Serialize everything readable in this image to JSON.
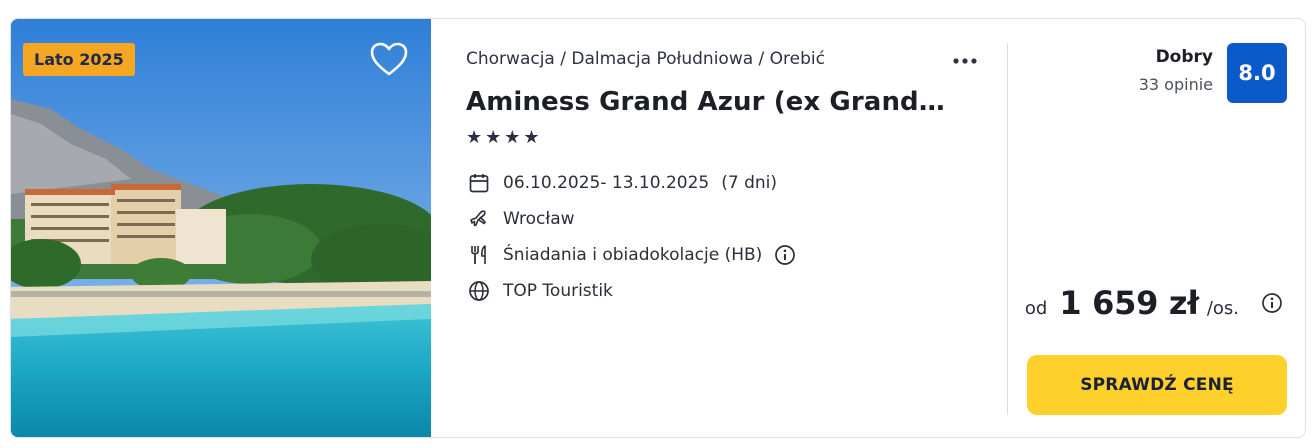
{
  "image": {
    "badge": "Lato 2025",
    "favorite_icon": "heart-outline-icon"
  },
  "info": {
    "breadcrumb": "Chorwacja / Dalmacja Południowa / Orebić",
    "more_icon": "ellipsis-icon",
    "hotel_name": "Aminess Grand Azur (ex Grand…",
    "stars": "★★★★",
    "star_count": 4,
    "dates": "06.10.2025- 13.10.2025",
    "duration": "(7 dni)",
    "departure": "Wrocław",
    "board": "Śniadania i obiadokolacje (HB)",
    "operator": "TOP Touristik"
  },
  "rating": {
    "label": "Dobry",
    "count": "33 opinie",
    "score": "8.0"
  },
  "price": {
    "prefix": "od",
    "value": "1 659 zł",
    "unit": "/os."
  },
  "cta": {
    "label": "SPRAWDŹ CENĘ"
  },
  "colors": {
    "badge": "#f5a623",
    "rating_badge": "#0a5bc9",
    "cta": "#fdd02c"
  }
}
